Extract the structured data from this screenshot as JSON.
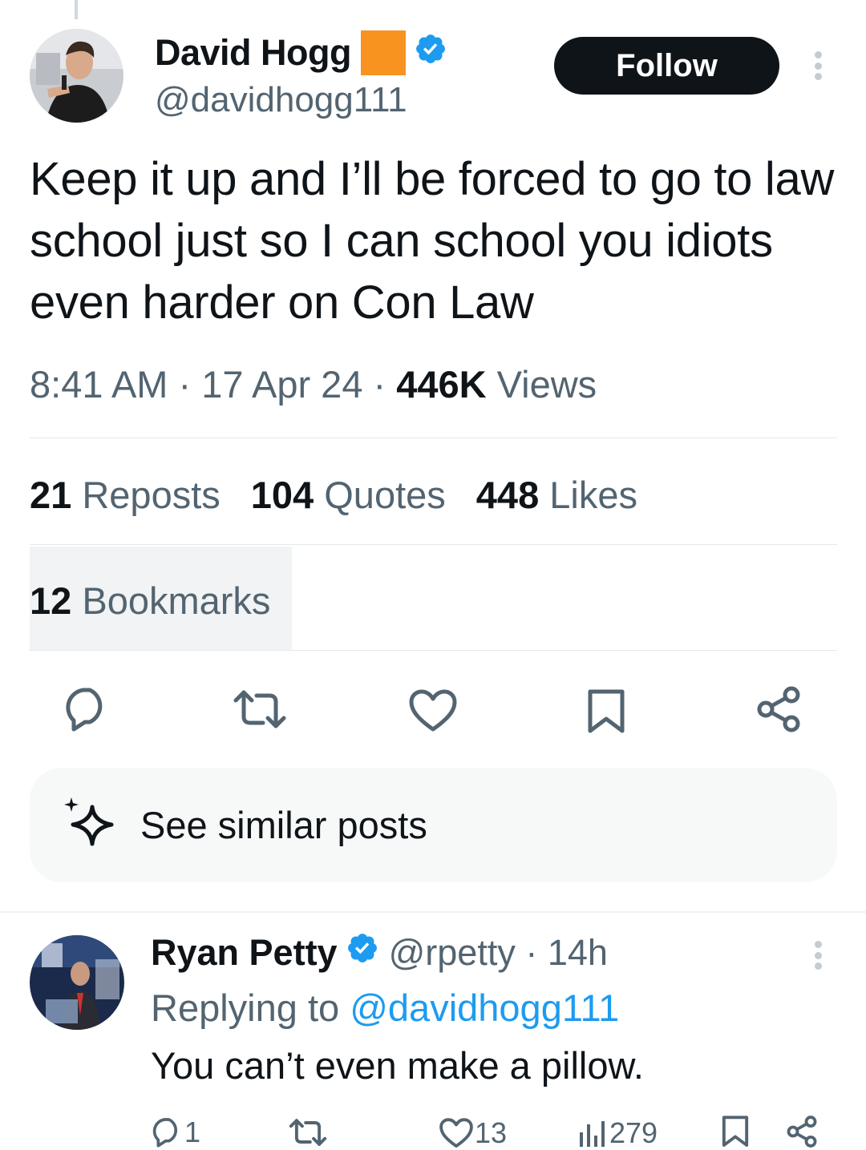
{
  "post": {
    "author_name": "David Hogg",
    "handle": "@davidhogg111",
    "follow_label": "Follow",
    "text": "Keep it up and I’ll be forced to go to law school just so I can school you idiots even harder on Con Law",
    "time": "8:41 AM",
    "date": "17 Apr 24",
    "views_count": "446K",
    "views_label": "Views",
    "stats": {
      "reposts_count": "21",
      "reposts_label": "Reposts",
      "quotes_count": "104",
      "quotes_label": "Quotes",
      "likes_count": "448",
      "likes_label": "Likes",
      "bookmarks_count": "12",
      "bookmarks_label": "Bookmarks"
    },
    "see_similar_label": "See similar posts"
  },
  "reply": {
    "author_name": "Ryan Petty",
    "handle": "@rpetty",
    "age": "14h",
    "replying_prefix": "Replying to",
    "replying_to": "@davidhogg111",
    "text": "You can’t even make a pillow.",
    "reply_count": "1",
    "like_count": "13",
    "view_count": "279"
  },
  "colors": {
    "text": "#0f1419",
    "secondary": "#536471",
    "accent": "#1d9bf0",
    "badge_orange": "#f7931e",
    "follow_bg": "#0f1419"
  },
  "icons": [
    "verified-badge-icon",
    "more-icon",
    "reply-icon",
    "repost-icon",
    "like-icon",
    "bookmark-icon",
    "share-icon",
    "sparkle-icon",
    "views-icon"
  ]
}
